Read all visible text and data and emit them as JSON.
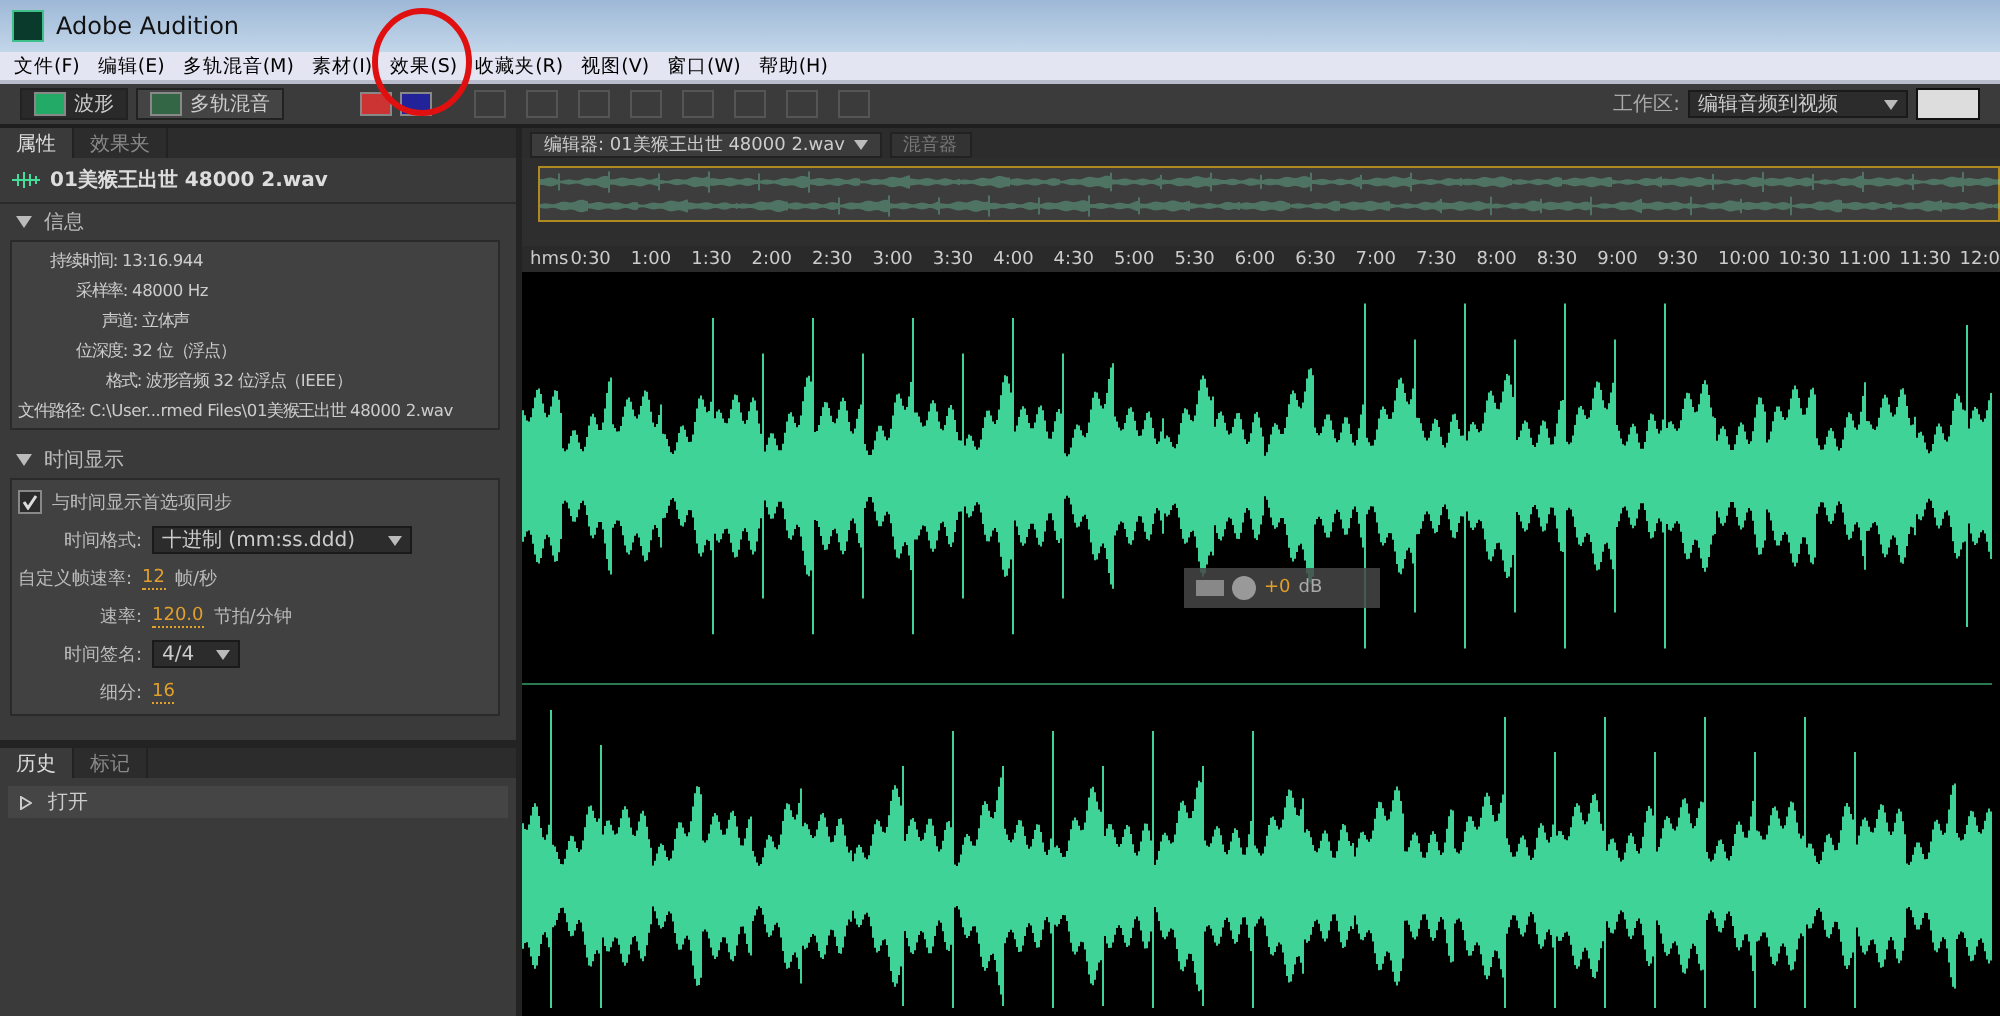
{
  "window": {
    "title": "Adobe Audition"
  },
  "menu": [
    "文件(F)",
    "编辑(E)",
    "多轨混音(M)",
    "素材(I)",
    "效果(S)",
    "收藏夹(R)",
    "视图(V)",
    "窗口(W)",
    "帮助(H)"
  ],
  "views": [
    {
      "label": "波形",
      "selected": true
    },
    {
      "label": "多轨混音",
      "selected": false
    }
  ],
  "workspace": {
    "label": "工作区:",
    "value": "编辑音频到视频"
  },
  "left_tabs": [
    {
      "label": "属性",
      "selected": true
    },
    {
      "label": "效果夹",
      "selected": false
    }
  ],
  "file": "01美猴王出世 48000 2.wav",
  "info": {
    "title": "信息",
    "expanded": true,
    "rows": [
      {
        "label": "持续时间:",
        "value": "13:16.944"
      },
      {
        "label": "采样率:",
        "value": "48000 Hz"
      },
      {
        "label": "声道:",
        "value": "立体声"
      },
      {
        "label": "位深度:",
        "value": "32 位（浮点）"
      },
      {
        "label": "格式:",
        "value": "波形音频 32 位浮点（IEEE）"
      },
      {
        "label": "文件路径:",
        "value": "C:\\User...rmed Files\\01美猴王出世 48000 2.wav"
      }
    ]
  },
  "time_display": {
    "title": "时间显示",
    "expanded": true,
    "sync": {
      "label": "与时间显示首选项同步",
      "checked": true
    },
    "format": {
      "label": "时间格式:",
      "value": "十进制 (mm:ss.ddd)"
    },
    "frame_rate": {
      "label": "自定义帧速率:",
      "value": "12",
      "unit": "帧/秒"
    },
    "tempo": {
      "label": "速率:",
      "value": "120.0",
      "unit": "节拍/分钟"
    },
    "signature": {
      "label": "时间签名:",
      "value": "4/4"
    },
    "subdivision": {
      "label": "细分:",
      "value": "16"
    }
  },
  "bottom_tabs": [
    {
      "label": "历史",
      "selected": true
    },
    {
      "label": "标记",
      "selected": false
    }
  ],
  "history": [
    {
      "label": "打开"
    }
  ],
  "editor_tabs": [
    {
      "label": "编辑器: 01美猴王出世 48000 2.wav",
      "selected": true
    },
    {
      "label": "混音器",
      "selected": false
    }
  ],
  "ruler": [
    "hms",
    "0:30",
    "1:00",
    "1:30",
    "2:00",
    "2:30",
    "3:00",
    "3:30",
    "4:00",
    "4:30",
    "5:00",
    "5:30",
    "6:00",
    "6:30",
    "7:00",
    "7:30",
    "8:00",
    "8:30",
    "9:00",
    "9:30",
    "10:00",
    "10:30",
    "11:00",
    "11:30",
    "12:0"
  ],
  "hud": {
    "value": "+0",
    "unit": "dB"
  }
}
